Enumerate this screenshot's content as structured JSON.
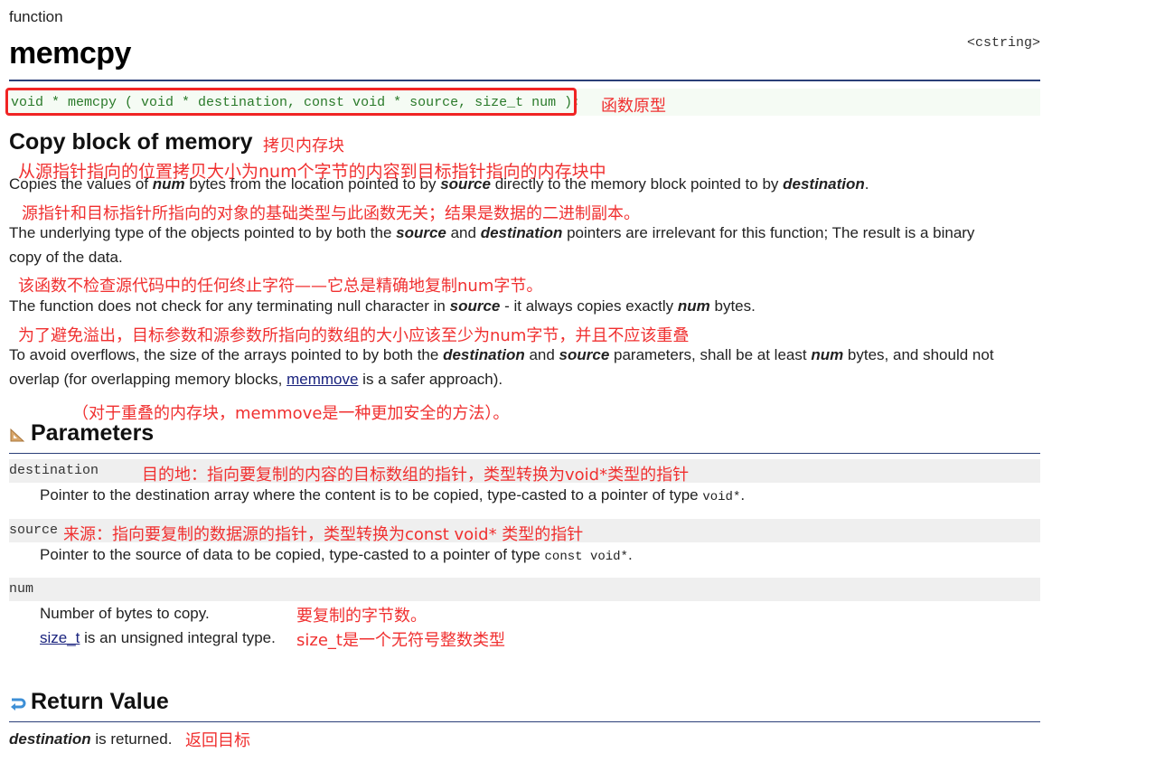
{
  "page": {
    "kind": "function",
    "title": "memcpy",
    "header_file": "<cstring>"
  },
  "prototype": {
    "code": "void * memcpy ( void * destination, const void * source, size_t num );",
    "note_cn": "函数原型"
  },
  "summary": {
    "heading": "Copy block of memory",
    "heading_cn": "拷贝内存块"
  },
  "description": {
    "p1_cn": "从源指针指向的位置拷贝大小为num个字节的内容到目标指针指向的内存块中",
    "p1": {
      "t1": "Copies the values of ",
      "b1": "num",
      "t2": " bytes from the location pointed to by ",
      "b2": "source",
      "t3": " directly to the memory block pointed to by ",
      "b3": "destination",
      "t4": "."
    },
    "p2_cn": "源指针和目标指针所指向的对象的基础类型与此函数无关；结果是数据的二进制副本。",
    "p2": {
      "t1": "The underlying type of the objects pointed to by both the ",
      "b1": "source",
      "t2": " and ",
      "b2": "destination",
      "t3": " pointers are irrelevant for this function; The result is a binary",
      "line2": "copy of the data."
    },
    "p3_cn": "该函数不检查源代码中的任何终止字符——它总是精确地复制num字节。",
    "p3": {
      "t1": "The function does not check for any terminating null character in ",
      "b1": "source",
      "t2": " - it always copies exactly ",
      "b2": "num",
      "t3": " bytes."
    },
    "p4_cn": "为了避免溢出，目标参数和源参数所指向的数组的大小应该至少为num字节，并且不应该重叠",
    "p4": {
      "t1": "To avoid overflows, the size of the arrays pointed to by both the ",
      "b1": "destination",
      "t2": " and ",
      "b2": "source",
      "t3": " parameters, shall be at least ",
      "b3": "num",
      "t4": " bytes, and should not",
      "line2_t1": "overlap (for overlapping memory blocks, ",
      "link": "memmove",
      "line2_t2": " is a safer approach)."
    },
    "p4b_cn": "（对于重叠的内存块，memmove是一种更加安全的方法）。"
  },
  "parameters": {
    "heading": "Parameters",
    "icon": "ruler-triangle-icon",
    "items": [
      {
        "name": "destination",
        "name_cn": "目的地：指向要复制的内容的目标数组的指针，类型转换为void*类型的指针",
        "desc": "Pointer to the destination array where the content is to be copied, type-casted to a pointer of type ",
        "type": "void*",
        "tail": "."
      },
      {
        "name": "source",
        "name_cn": "来源：指向要复制的数据源的指针，类型转换为const void* 类型的指针",
        "desc": "Pointer to the source of data to be copied, type-casted to a pointer of type ",
        "type": "const void*",
        "tail": "."
      },
      {
        "name": "num",
        "desc": "Number of bytes to copy.",
        "desc_cn": "要复制的字节数。",
        "link": "size_t",
        "desc2": " is an unsigned integral type.",
        "desc2_cn": "size_t是一个无符号整数类型"
      }
    ]
  },
  "return_value": {
    "heading": "Return Value",
    "icon": "return-arrow-icon",
    "b1": "destination",
    "t1": " is returned.",
    "note_cn": "返回目标"
  }
}
